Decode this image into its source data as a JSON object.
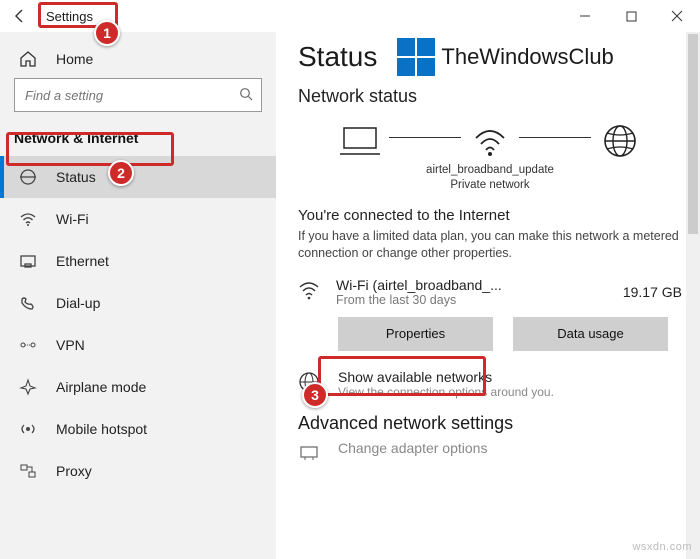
{
  "titlebar": {
    "title": "Settings"
  },
  "sidebar": {
    "home_label": "Home",
    "search_placeholder": "Find a setting",
    "category_label": "Network & Internet",
    "items": [
      {
        "label": "Status"
      },
      {
        "label": "Wi-Fi"
      },
      {
        "label": "Ethernet"
      },
      {
        "label": "Dial-up"
      },
      {
        "label": "VPN"
      },
      {
        "label": "Airplane mode"
      },
      {
        "label": "Mobile hotspot"
      },
      {
        "label": "Proxy"
      }
    ]
  },
  "branding": {
    "text": "TheWindowsClub"
  },
  "content": {
    "page_title": "Status",
    "section_title": "Network status",
    "diagram": {
      "ssid": "airtel_broadband_update",
      "network_type": "Private network"
    },
    "connected_heading": "You're connected to the Internet",
    "connected_desc": "If you have a limited data plan, you can make this network a metered connection or change other properties.",
    "network": {
      "name": "Wi-Fi (airtel_broadband_...",
      "period": "From the last 30 days",
      "usage": "19.17 GB"
    },
    "buttons": {
      "properties": "Properties",
      "data_usage": "Data usage"
    },
    "show_networks": {
      "title": "Show available networks",
      "sub": "View the connection options around you."
    },
    "advanced_title": "Advanced network settings",
    "change_adapter": "Change adapter options"
  },
  "annotations": {
    "b1": "1",
    "b2": "2",
    "b3": "3"
  },
  "watermark": "wsxdn.com"
}
